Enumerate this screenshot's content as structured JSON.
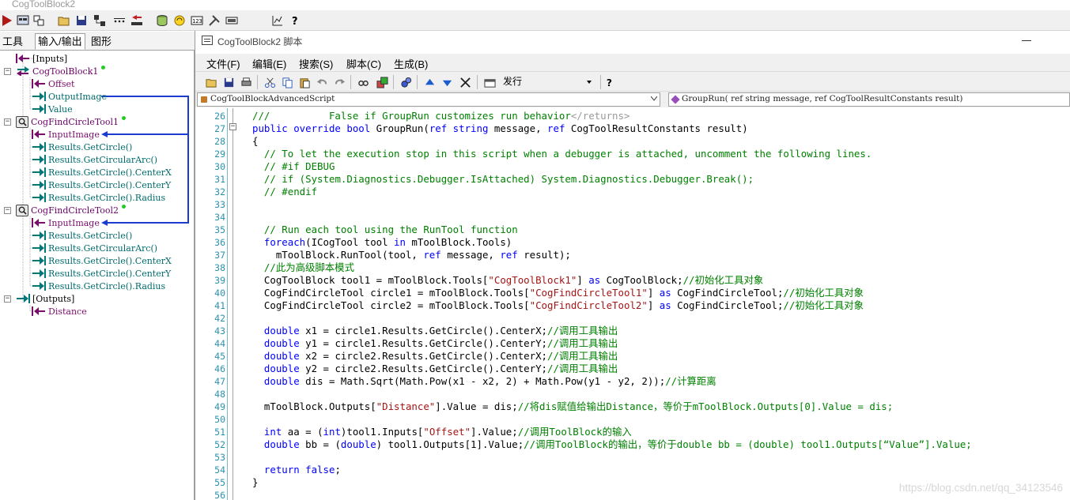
{
  "main_window": {
    "title": "CogToolBlock2"
  },
  "main_toolbar": {
    "icons": [
      "run-icon",
      "display-icon",
      "link-icon",
      "open-icon",
      "save-icon",
      "network-icon",
      "ellipsis-icon",
      "sort-icon",
      "database-icon",
      "refresh-icon",
      "numeric-icon",
      "tools-icon",
      "serial-icon",
      "chart-icon",
      "help-icon"
    ]
  },
  "left_panel": {
    "tabs": [
      "工具",
      "输入/输出",
      "图形"
    ],
    "active_tab": "工具",
    "tree": [
      {
        "label": "[Inputs]",
        "kind": "input-group"
      },
      {
        "label": "CogToolBlock1",
        "kind": "tool"
      },
      {
        "label": "Offset",
        "kind": "input"
      },
      {
        "label": "OutputImage",
        "kind": "output"
      },
      {
        "label": "Value",
        "kind": "output"
      },
      {
        "label": "CogFindCircleTool1",
        "kind": "tool"
      },
      {
        "label": "InputImage",
        "kind": "input"
      },
      {
        "label": "Results.GetCircle()",
        "kind": "output"
      },
      {
        "label": "Results.GetCircularArc()",
        "kind": "output"
      },
      {
        "label": "Results.GetCircle().CenterX",
        "kind": "output"
      },
      {
        "label": "Results.GetCircle().CenterY",
        "kind": "output"
      },
      {
        "label": "Results.GetCircle().Radius",
        "kind": "output"
      },
      {
        "label": "CogFindCircleTool2",
        "kind": "tool"
      },
      {
        "label": "InputImage",
        "kind": "input"
      },
      {
        "label": "Results.GetCircle()",
        "kind": "output"
      },
      {
        "label": "Results.GetCircularArc()",
        "kind": "output"
      },
      {
        "label": "Results.GetCircle().CenterX",
        "kind": "output"
      },
      {
        "label": "Results.GetCircle().CenterY",
        "kind": "output"
      },
      {
        "label": "Results.GetCircle().Radius",
        "kind": "output"
      },
      {
        "label": "[Outputs]",
        "kind": "output-group"
      },
      {
        "label": "Distance",
        "kind": "input"
      }
    ]
  },
  "script_window": {
    "title": "CogToolBlock2 脚本",
    "menu": [
      "文件(F)",
      "编辑(E)",
      "搜索(S)",
      "脚本(C)",
      "生成(B)"
    ],
    "build_config": "发行",
    "class_combo": "CogToolBlockAdvancedScript",
    "member_combo": "GroupRun( ref string message,  ref CogToolResultConstants result)",
    "watermark": "https://blog.csdn.net/qq_34123546"
  },
  "code_lines": [
    {
      "n": "26",
      "html": "<span class=\"cm\">///          False if GroupRun customizes run behavior</span><span class=\"dim\">&lt;/returns&gt;</span>",
      "indent": 0
    },
    {
      "n": "27",
      "html": "<span class=\"kw\">public override bool</span> GroupRun(<span class=\"kw\">ref string</span> message, <span class=\"kw\">ref</span> CogToolResultConstants result)",
      "indent": 0
    },
    {
      "n": "28",
      "html": "{",
      "indent": 0
    },
    {
      "n": "29",
      "html": "  <span class=\"cm\">// To let the execution stop in this script when a debugger is attached, uncomment the following lines.</span>",
      "indent": 0
    },
    {
      "n": "30",
      "html": "  <span class=\"cm\">// #if DEBUG</span>",
      "indent": 0
    },
    {
      "n": "31",
      "html": "  <span class=\"cm\">// if (System.Diagnostics.Debugger.IsAttached) System.Diagnostics.Debugger.Break();</span>",
      "indent": 0
    },
    {
      "n": "32",
      "html": "  <span class=\"cm\">// #endif</span>",
      "indent": 0
    },
    {
      "n": "33",
      "html": "",
      "indent": 0
    },
    {
      "n": "34",
      "html": "",
      "indent": 0
    },
    {
      "n": "35",
      "html": "  <span class=\"cm\">// Run each tool using the RunTool function</span>",
      "indent": 0
    },
    {
      "n": "36",
      "html": "  <span class=\"kw\">foreach</span>(ICogTool tool <span class=\"kw\">in</span> mToolBlock.Tools)",
      "indent": 0
    },
    {
      "n": "37",
      "html": "    mToolBlock.RunTool(tool, <span class=\"kw\">ref</span> message, <span class=\"kw\">ref</span> result);",
      "indent": 0
    },
    {
      "n": "38",
      "html": "  <span class=\"cm\">//此为高级脚本模式</span>",
      "indent": 0
    },
    {
      "n": "39",
      "html": "  CogToolBlock tool1 = mToolBlock.Tools[<span class=\"st\">\"CogToolBlock1\"</span>] <span class=\"kw\">as</span> CogToolBlock;<span class=\"cm\">//初始化工具对象</span>",
      "indent": 0
    },
    {
      "n": "40",
      "html": "  CogFindCircleTool circle1 = mToolBlock.Tools[<span class=\"st\">\"CogFindCircleTool1\"</span>] <span class=\"kw\">as</span> CogFindCircleTool;<span class=\"cm\">//初始化工具对象</span>",
      "indent": 0
    },
    {
      "n": "41",
      "html": "  CogFindCircleTool circle2 = mToolBlock.Tools[<span class=\"st\">\"CogFindCircleTool2\"</span>] <span class=\"kw\">as</span> CogFindCircleTool;<span class=\"cm\">//初始化工具对象</span>",
      "indent": 0
    },
    {
      "n": "42",
      "html": "",
      "indent": 0
    },
    {
      "n": "43",
      "html": "  <span class=\"kw\">double</span> x1 = circle1.Results.GetCircle().CenterX;<span class=\"cm\">//调用工具输出</span>",
      "indent": 0
    },
    {
      "n": "44",
      "html": "  <span class=\"kw\">double</span> y1 = circle1.Results.GetCircle().CenterY;<span class=\"cm\">//调用工具输出</span>",
      "indent": 0
    },
    {
      "n": "45",
      "html": "  <span class=\"kw\">double</span> x2 = circle2.Results.GetCircle().CenterX;<span class=\"cm\">//调用工具输出</span>",
      "indent": 0
    },
    {
      "n": "46",
      "html": "  <span class=\"kw\">double</span> y2 = circle2.Results.GetCircle().CenterY;<span class=\"cm\">//调用工具输出</span>",
      "indent": 0
    },
    {
      "n": "47",
      "html": "  <span class=\"kw\">double</span> dis = Math.Sqrt(Math.Pow(x1 - x2, 2) + Math.Pow(y1 - y2, 2));<span class=\"cm\">//计算距离</span>",
      "indent": 0
    },
    {
      "n": "48",
      "html": "",
      "indent": 0
    },
    {
      "n": "49",
      "html": "  mToolBlock.Outputs[<span class=\"st\">\"Distance\"</span>].Value = dis;<span class=\"cm\">//将dis赋值给输出Distance，等价于mToolBlock.Outputs[0].Value = dis;</span>",
      "indent": 0
    },
    {
      "n": "50",
      "html": "",
      "indent": 0
    },
    {
      "n": "51",
      "html": "  <span class=\"kw\">int</span> aa = (<span class=\"kw\">int</span>)tool1.Inputs[<span class=\"st\">\"Offset\"</span>].Value;<span class=\"cm\">//调用ToolBlock的输入</span>",
      "indent": 0
    },
    {
      "n": "52",
      "html": "  <span class=\"kw\">double</span> bb = (<span class=\"kw\">double</span>) tool1.Outputs[1].Value;<span class=\"cm\">//调用ToolBlock的输出，等价于double bb = (double) tool1.Outputs[“Value”].Value;</span>",
      "indent": 0
    },
    {
      "n": "53",
      "html": "",
      "indent": 0
    },
    {
      "n": "54",
      "html": "  <span class=\"kw\">return false</span>;",
      "indent": 0
    },
    {
      "n": "55",
      "html": "}",
      "indent": 0
    },
    {
      "n": "56",
      "html": "",
      "indent": 0
    }
  ]
}
